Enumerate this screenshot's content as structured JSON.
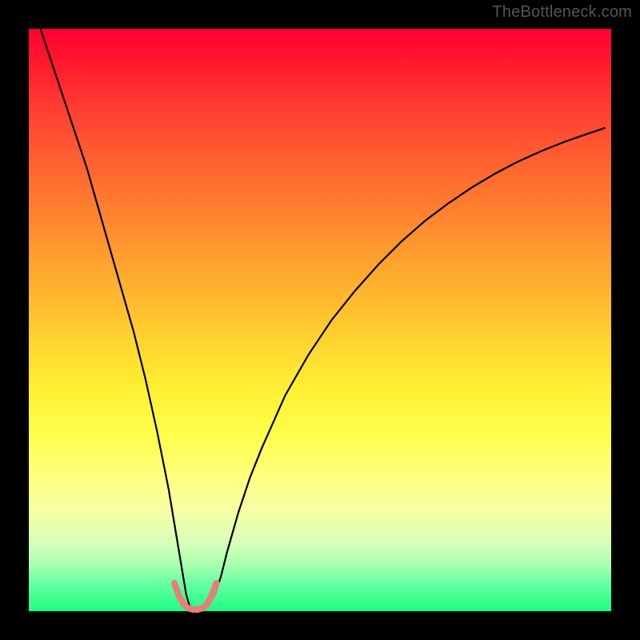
{
  "watermark": "TheBottleneck.com",
  "chart_data": {
    "type": "line",
    "title": "",
    "xlabel": "",
    "ylabel": "",
    "xlim": [
      0,
      100
    ],
    "ylim": [
      0,
      100
    ],
    "grid": false,
    "series": [
      {
        "name": "curve",
        "stroke": "#000000",
        "stroke_width": 2.2,
        "x": [
          2,
          4,
          6,
          8,
          10,
          12,
          14,
          16,
          18,
          20,
          22,
          23,
          24,
          25,
          26,
          26.5,
          27,
          27.5,
          28,
          28.5,
          29,
          30,
          31,
          32,
          33,
          34,
          36,
          38,
          40,
          44,
          48,
          52,
          56,
          60,
          64,
          68,
          72,
          76,
          80,
          84,
          88,
          92,
          96,
          99
        ],
        "y": [
          100,
          94,
          88,
          82,
          76,
          69,
          62,
          55,
          48,
          40,
          31,
          26,
          21,
          15,
          9,
          6,
          3,
          1.2,
          0.4,
          0.2,
          0.2,
          0.4,
          1.2,
          3,
          6,
          10,
          17,
          23,
          28,
          37,
          44,
          50,
          55,
          59.5,
          63.5,
          67,
          70,
          72.7,
          75.1,
          77.2,
          79,
          80.6,
          82,
          83
        ]
      },
      {
        "name": "basin-markers",
        "type": "scatter-line",
        "stroke": "#e77f7a",
        "fill": "#e77f7a",
        "stroke_width": 8,
        "marker_radius": 4.2,
        "x": [
          25.0,
          25.8,
          26.6,
          27.4,
          28.2,
          29.0,
          29.8,
          30.6,
          31.4,
          32.2
        ],
        "y": [
          4.8,
          2.6,
          1.2,
          0.5,
          0.3,
          0.3,
          0.5,
          1.2,
          2.6,
          4.8
        ]
      }
    ],
    "background_gradient": {
      "direction": "vertical",
      "stops": [
        {
          "pos": 0.0,
          "color": "#ff0033"
        },
        {
          "pos": 0.3,
          "color": "#ff7c2f"
        },
        {
          "pos": 0.62,
          "color": "#fff033"
        },
        {
          "pos": 0.83,
          "color": "#f5ffa6"
        },
        {
          "pos": 1.0,
          "color": "#1fff80"
        }
      ]
    }
  }
}
